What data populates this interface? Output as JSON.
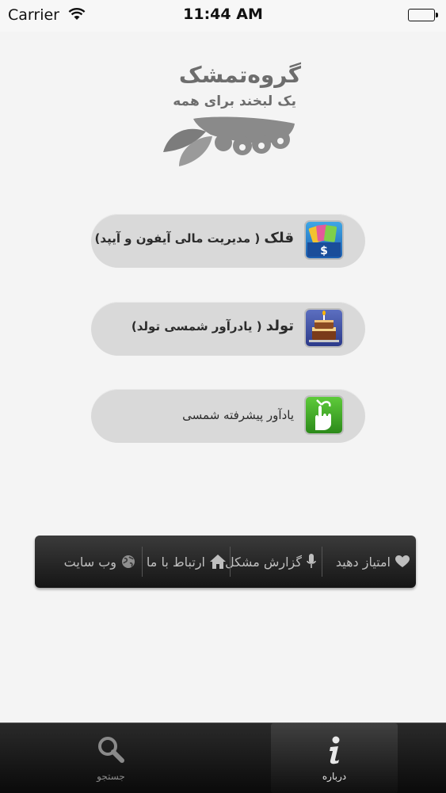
{
  "status_bar": {
    "carrier": "Carrier",
    "time": "11:44 AM"
  },
  "logo": {
    "name": "گروه‌تمشک",
    "tagline": "یک لبخند برای همه"
  },
  "apps": [
    {
      "title": "قلک",
      "subtitle": "( مدیریت مالی آیفون و آیپد)",
      "icon": "money-card-icon"
    },
    {
      "title": "تولد",
      "subtitle": "( یادرآور شمسی تولد)",
      "icon": "birthday-cake-icon"
    },
    {
      "title": "",
      "subtitle": "یادآور پیشرفته شمسی",
      "icon": "finger-ribbon-icon"
    }
  ],
  "links": [
    {
      "label": "امتیاز دهید",
      "icon": "heart-icon"
    },
    {
      "label": "گزارش مشکل",
      "icon": "microphone-icon"
    },
    {
      "label": "ارتباط با ما",
      "icon": "home-icon"
    },
    {
      "label": "وب سایت",
      "icon": "globe-icon"
    }
  ],
  "tabs": [
    {
      "label": "جستجو",
      "icon": "search-icon",
      "active": false
    },
    {
      "label": "درباره",
      "icon": "info-icon",
      "active": true
    }
  ],
  "colors": {
    "background": "#f4f4f4",
    "button": "#d9d9d9",
    "bar_dark": "#1f1f1f"
  }
}
